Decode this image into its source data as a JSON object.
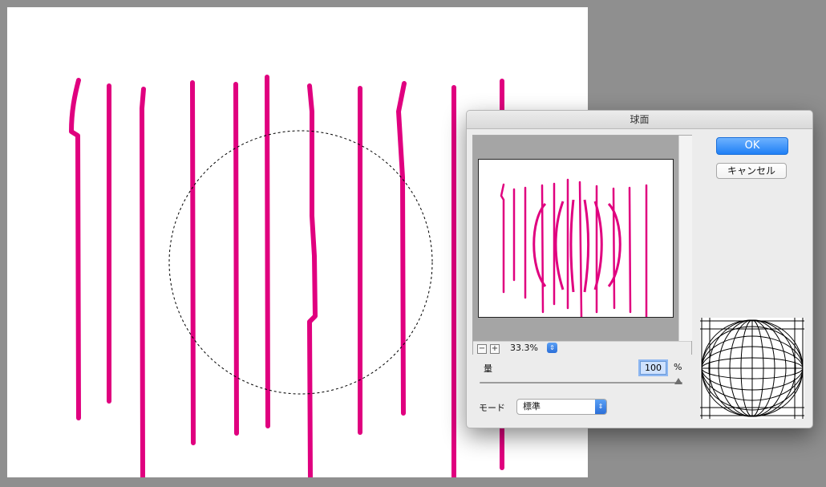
{
  "dialog": {
    "title": "球面",
    "ok_label": "OK",
    "cancel_label": "キャンセル",
    "zoom_out_symbol": "−",
    "zoom_in_symbol": "+",
    "zoom_level": "33.3%",
    "amount_label": "量",
    "amount_value": "100",
    "amount_unit": "%",
    "amount_fraction": 1.0,
    "mode_label": "モード",
    "mode_value": "標準"
  },
  "colors": {
    "stroke": "#e0007f",
    "ok_button": "#1f7ff5"
  },
  "icons": {
    "zoom_stepper": "up-down-chevron-icon",
    "mode_arrow": "up-down-chevron-icon",
    "sphere_thumbnail": "sphere-grid-icon"
  }
}
